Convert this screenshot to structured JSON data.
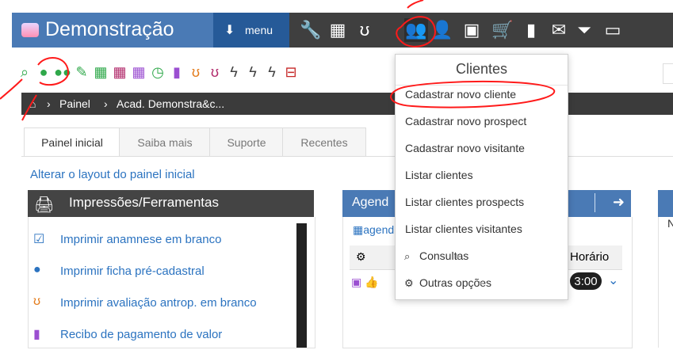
{
  "header": {
    "brand": "Demonstração",
    "menu_label": "menu"
  },
  "breadcrumb": {
    "home": "",
    "items": [
      "Painel",
      "Acad. Demonstra&c..."
    ]
  },
  "tabs": [
    "Painel inicial",
    "Saiba mais",
    "Suporte",
    "Recentes"
  ],
  "links": {
    "alterar_layout": "Alterar o layout do painel inicial"
  },
  "panels": {
    "impressoes": {
      "title": "Impressões/Ferramentas",
      "items": [
        "Imprimir anamnese em branco",
        "Imprimir ficha pré-cadastral",
        "Imprimir avaliação antrop. em branco",
        "Recibo de pagamento de valor"
      ]
    },
    "agenda": {
      "title": "Agend",
      "link": "agend",
      "col_horario": "Horário",
      "time_badge": "3:00"
    },
    "right": {
      "letter": "N"
    }
  },
  "dropdown": {
    "title": "Clientes",
    "items": [
      "Cadastrar novo cliente",
      "Cadastrar novo prospect",
      "Cadastrar novo visitante",
      "Listar clientes",
      "Listar clientes prospects",
      "Listar clientes visitantes",
      "Consultas",
      "Outras opções"
    ]
  },
  "toolbar": {
    "icons": [
      {
        "name": "search-icon",
        "color": "#2fa84a",
        "glyph": "⌕"
      },
      {
        "name": "user-icon",
        "color": "#2fa84a",
        "glyph": "●"
      },
      {
        "name": "users-icon",
        "color": "#2fa84a",
        "glyph": "●●"
      },
      {
        "name": "pencil-icon",
        "color": "#2fa84a",
        "glyph": "✎"
      },
      {
        "name": "calendar-icon",
        "color": "#2fa84a",
        "glyph": "▦"
      },
      {
        "name": "calendar-icon",
        "color": "#b12a6b",
        "glyph": "▦"
      },
      {
        "name": "calendar-icon",
        "color": "#9b4fd1",
        "glyph": "▦"
      },
      {
        "name": "clock-icon",
        "color": "#2fa84a",
        "glyph": "◷"
      },
      {
        "name": "bookmark-icon",
        "color": "#9b4fd1",
        "glyph": "▮"
      },
      {
        "name": "stethoscope-icon",
        "color": "#e37b1b",
        "glyph": "ʊ"
      },
      {
        "name": "stethoscope-icon",
        "color": "#b12a6b",
        "glyph": "ʊ"
      },
      {
        "name": "bolt-icon",
        "color": "#444",
        "glyph": "ϟ"
      },
      {
        "name": "bolt-icon",
        "color": "#444",
        "glyph": "ϟ"
      },
      {
        "name": "bolt-icon",
        "color": "#444",
        "glyph": "ϟ"
      },
      {
        "name": "money-icon",
        "color": "#c62828",
        "glyph": "⊟"
      }
    ]
  }
}
